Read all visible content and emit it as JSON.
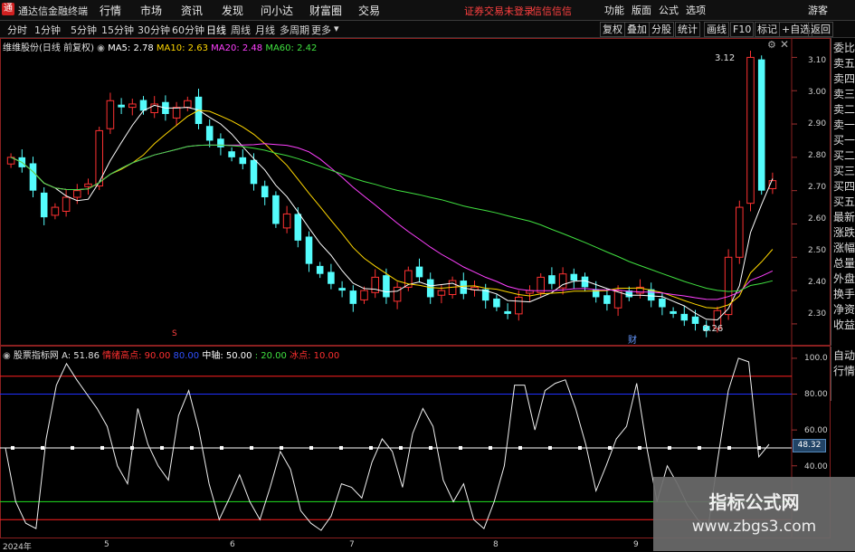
{
  "menubar": {
    "logo": "通",
    "title": "通达信金融终端",
    "items": [
      "行情",
      "市场",
      "资讯",
      "发现",
      "问小达",
      "财富圈",
      "交易"
    ],
    "warning1": "证券交易未登录",
    "warning2": "信信信信",
    "right_items": [
      "功能",
      "版面",
      "公式",
      "选项"
    ],
    "guest": "游客"
  },
  "toolbar": {
    "periods": [
      "分时",
      "1分钟",
      "5分钟",
      "15分钟",
      "30分钟",
      "60分钟",
      "日线",
      "周线",
      "月线",
      "多周期",
      "更多"
    ],
    "active": "日线",
    "right_buttons": [
      "复权",
      "叠加",
      "分股",
      "统计",
      "画线",
      "F10",
      "标记",
      "+自选",
      "返回"
    ]
  },
  "main_legend": {
    "stock": "维维股份(日线 前复权)",
    "ma5": "MA5: 2.78",
    "ma10": "MA10: 2.63",
    "ma20": "MA20: 2.48",
    "ma60": "MA60: 2.42",
    "colors": {
      "ma5": "#ffffff",
      "ma10": "#ffd700",
      "ma20": "#ff40ff",
      "ma60": "#40e040"
    }
  },
  "ind_legend": {
    "name": "股票指标网",
    "a": "A: 51.86",
    "high": "情绪高点: 90.00",
    "blue": "80.00",
    "mid": "中轴: 50.00",
    "low": ": 20.00",
    "ice": "冰点: 10.00"
  },
  "side_panel": [
    "委比",
    "卖五",
    "卖四",
    "卖三",
    "卖二",
    "卖一",
    "买一",
    "买二",
    "买三",
    "买四",
    "买五",
    "最新",
    "涨跌",
    "涨幅",
    "总量",
    "外盘",
    "换手",
    "净资",
    "收益"
  ],
  "side_panel2": [
    "自动",
    "行情"
  ],
  "price_axis": [
    "3.10",
    "3.00",
    "2.90",
    "2.80",
    "2.70",
    "2.60",
    "2.50",
    "2.40",
    "2.30"
  ],
  "ind_axis": [
    "100.0",
    "80.00",
    "60.00",
    "40.00"
  ],
  "readout": "48.32",
  "dates": [
    "2024年",
    "5",
    "6",
    "7",
    "8",
    "9"
  ],
  "annotations": {
    "high": "3.12",
    "low": "2.26",
    "marker1": "S",
    "marker2": "财"
  },
  "watermark": {
    "line1": "指标公式网",
    "line2": "www.zbgs3.com"
  },
  "chart_data": [
    {
      "type": "candlestick",
      "title": "维维股份(日线 前复权)",
      "ylim": [
        2.24,
        3.15
      ],
      "ticks": [
        3.1,
        3.0,
        2.9,
        2.8,
        2.7,
        2.6,
        2.5,
        2.4,
        2.3
      ],
      "closes": [
        2.8,
        2.77,
        2.7,
        2.62,
        2.65,
        2.68,
        2.7,
        2.72,
        2.88,
        2.97,
        2.95,
        2.96,
        2.94,
        2.96,
        2.93,
        2.95,
        2.97,
        2.9,
        2.85,
        2.83,
        2.8,
        2.78,
        2.72,
        2.68,
        2.6,
        2.63,
        2.55,
        2.48,
        2.45,
        2.42,
        2.4,
        2.36,
        2.4,
        2.44,
        2.38,
        2.41,
        2.46,
        2.44,
        2.38,
        2.4,
        2.43,
        2.39,
        2.41,
        2.37,
        2.35,
        2.33,
        2.38,
        2.4,
        2.44,
        2.42,
        2.45,
        2.43,
        2.41,
        2.38,
        2.36,
        2.4,
        2.38,
        2.41,
        2.37,
        2.35,
        2.33,
        2.31,
        2.3,
        2.28,
        2.34,
        2.5,
        2.65,
        3.1,
        2.7,
        2.73
      ],
      "high": 3.12,
      "low": 2.26,
      "ma_series": [
        {
          "name": "MA5",
          "last": 2.78
        },
        {
          "name": "MA10",
          "last": 2.63
        },
        {
          "name": "MA20",
          "last": 2.48
        },
        {
          "name": "MA60",
          "last": 2.42
        }
      ]
    },
    {
      "type": "line",
      "title": "股票指标网",
      "ylim": [
        0,
        105
      ],
      "ticks": [
        100,
        80,
        60,
        40
      ],
      "levels": [
        90,
        80,
        50,
        20,
        10
      ],
      "values": [
        50,
        20,
        8,
        5,
        55,
        85,
        97,
        88,
        80,
        72,
        62,
        40,
        30,
        72,
        52,
        40,
        32,
        68,
        82,
        60,
        30,
        10,
        22,
        35,
        20,
        10,
        28,
        48,
        38,
        15,
        8,
        4,
        12,
        30,
        28,
        22,
        42,
        55,
        48,
        28,
        58,
        72,
        62,
        32,
        20,
        30,
        10,
        5,
        20,
        40,
        85,
        85,
        60,
        82,
        86,
        88,
        72,
        52,
        26,
        40,
        55,
        62,
        86,
        50,
        20,
        40,
        30,
        18,
        10,
        5,
        45,
        82,
        100,
        98,
        45,
        52
      ],
      "last": 51.86
    }
  ]
}
